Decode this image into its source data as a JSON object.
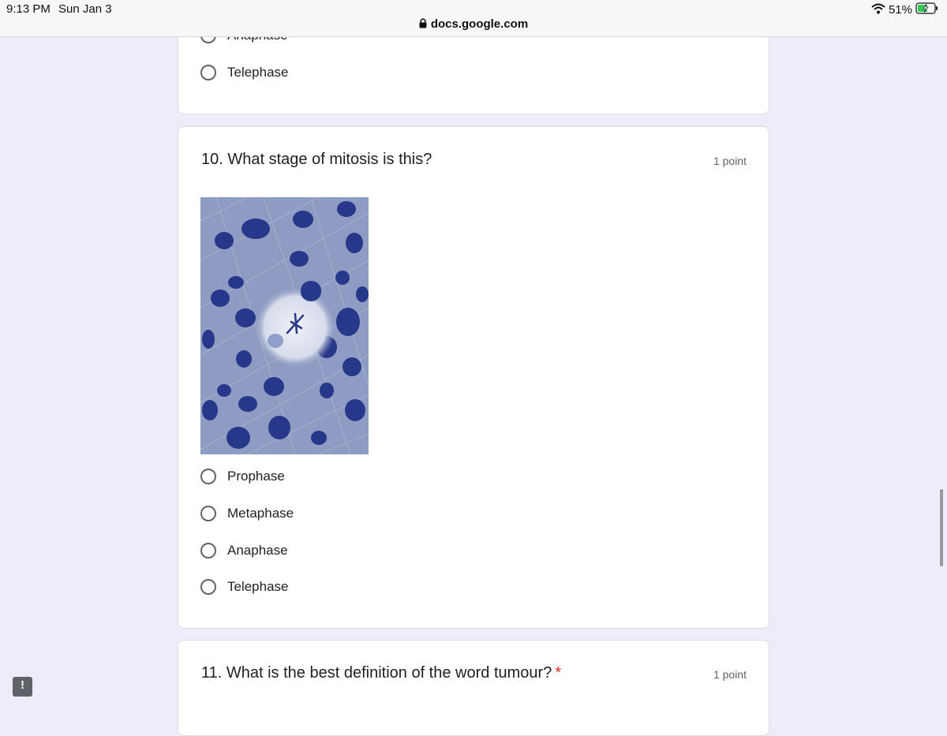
{
  "status_bar": {
    "time": "9:13 PM",
    "date": "Sun Jan 3",
    "battery": "51%",
    "url": "docs.google.com"
  },
  "previous_question": {
    "options": [
      "Anaphase",
      "Telephase"
    ]
  },
  "question10": {
    "title": "10. What stage of mitosis is this?",
    "points": "1 point",
    "options": [
      "Prophase",
      "Metaphase",
      "Anaphase",
      "Telephase"
    ]
  },
  "question11": {
    "title": "11. What is the best definition of the word tumour?",
    "required_mark": "*",
    "points": "1 point"
  },
  "report_button": "!",
  "colors": {
    "background": "#efebf8",
    "required": "#d93025",
    "battery_green": "#34c759"
  },
  "icons": [
    "wifi-icon",
    "battery-icon",
    "lock-icon",
    "report-icon"
  ]
}
